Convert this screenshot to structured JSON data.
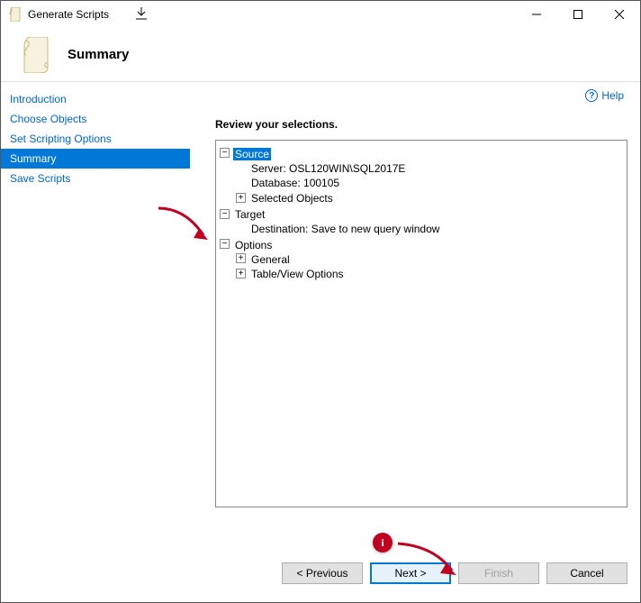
{
  "window": {
    "title": "Generate Scripts"
  },
  "winctrl": {
    "min": "minimize",
    "max": "maximize",
    "close": "close"
  },
  "header": {
    "title": "Summary"
  },
  "help": {
    "label": "Help"
  },
  "sidebar": {
    "items": [
      {
        "label": "Introduction"
      },
      {
        "label": "Choose Objects"
      },
      {
        "label": "Set Scripting Options"
      },
      {
        "label": "Summary"
      },
      {
        "label": "Save Scripts"
      }
    ],
    "active_index": 3
  },
  "content": {
    "subtitle": "Review your selections.",
    "tree": {
      "source": {
        "label": "Source",
        "server_label": "Server: OSL120WIN\\SQL2017E",
        "database_label": "Database: 100105",
        "selected_objects_label": "Selected Objects"
      },
      "target": {
        "label": "Target",
        "destination_label": "Destination: Save to new query window"
      },
      "options": {
        "label": "Options",
        "general_label": "General",
        "tableview_label": "Table/View Options"
      }
    }
  },
  "footer": {
    "previous": "< Previous",
    "next": "Next >",
    "finish": "Finish",
    "cancel": "Cancel"
  },
  "annotations": {
    "badge": "i"
  }
}
